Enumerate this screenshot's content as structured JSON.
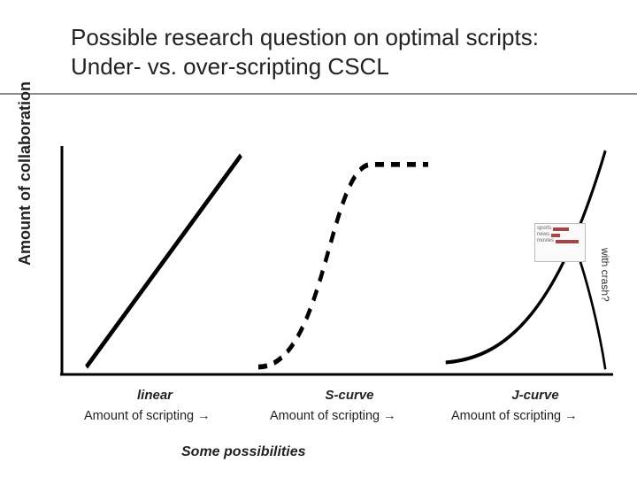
{
  "title": "Possible research question on optimal scripts: Under- vs. over-scripting CSCL",
  "ylabel": "Amount of collaboration",
  "panels": {
    "linear": {
      "label": "linear",
      "xlabel": "Amount of scripting →"
    },
    "scurve": {
      "label": "S-curve",
      "xlabel": "Amount of scripting →"
    },
    "jcurve": {
      "label": "J-curve",
      "xlabel": "Amount of scripting →"
    }
  },
  "crash_label": "with crash?",
  "footer": "Some possibilities",
  "chart_data": [
    {
      "type": "line",
      "name": "linear",
      "title": "linear",
      "xlabel": "Amount of scripting",
      "ylabel": "Amount of collaboration",
      "style": "solid",
      "x": [
        0,
        1
      ],
      "y": [
        0,
        1
      ],
      "xlim": [
        0,
        1
      ],
      "ylim": [
        0,
        1
      ]
    },
    {
      "type": "line",
      "name": "S-curve",
      "title": "S-curve",
      "xlabel": "Amount of scripting",
      "ylabel": "Amount of collaboration",
      "style": "dashed",
      "x": [
        0.0,
        0.1,
        0.2,
        0.3,
        0.4,
        0.45,
        0.5,
        0.55,
        0.6,
        0.7,
        0.8,
        0.9,
        1.0
      ],
      "y": [
        0.03,
        0.04,
        0.06,
        0.1,
        0.22,
        0.4,
        0.6,
        0.78,
        0.88,
        0.94,
        0.97,
        0.98,
        0.99
      ],
      "xlim": [
        0,
        1
      ],
      "ylim": [
        0,
        1
      ]
    },
    {
      "type": "line",
      "name": "J-curve",
      "title": "J-curve",
      "xlabel": "Amount of scripting",
      "ylabel": "Amount of collaboration",
      "style": "solid",
      "series": [
        {
          "name": "main",
          "x": [
            0.0,
            0.15,
            0.3,
            0.45,
            0.6,
            0.72,
            0.82,
            0.9,
            0.95,
            1.0
          ],
          "y": [
            0.05,
            0.06,
            0.1,
            0.18,
            0.32,
            0.5,
            0.68,
            0.82,
            0.92,
            1.0
          ]
        },
        {
          "name": "crash-branch",
          "x": [
            0.82,
            0.9,
            0.96,
            1.0
          ],
          "y": [
            0.68,
            0.5,
            0.25,
            0.02
          ]
        }
      ],
      "annotation": "with crash?",
      "xlim": [
        0,
        1
      ],
      "ylim": [
        0,
        1
      ]
    }
  ]
}
